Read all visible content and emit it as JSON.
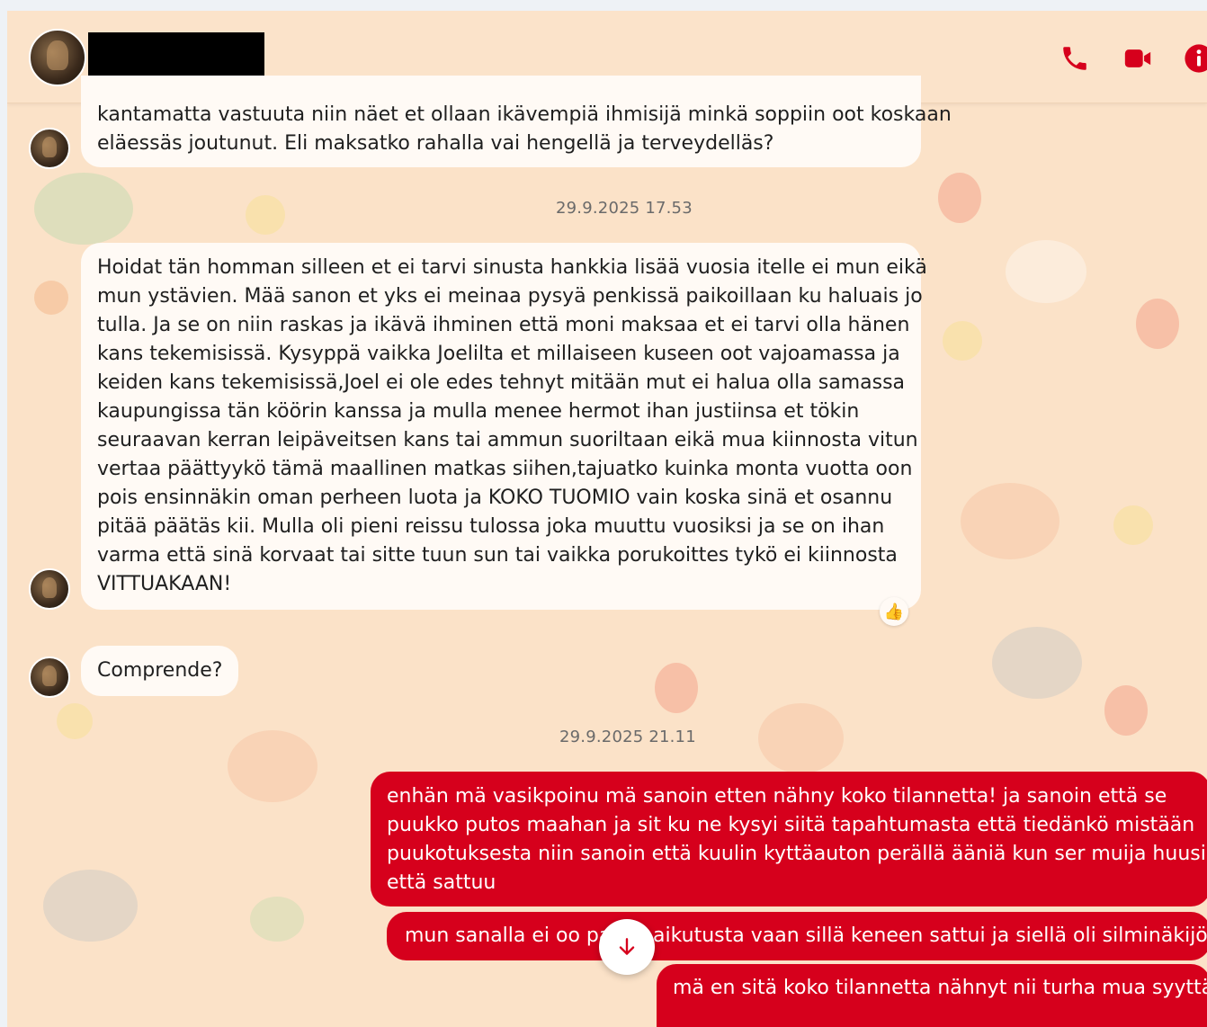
{
  "header": {
    "contact_name_redacted": "",
    "call_icon": "phone-icon",
    "video_icon": "video-camera-icon",
    "info_icon": "info-icon"
  },
  "colors": {
    "accent": "#d6001c",
    "background": "#fbe2c8",
    "incoming_bubble": "#fffaf5"
  },
  "messages": {
    "m1": {
      "lines": [
        "kantamatta vastuuta niin näet et ollaan ikävempiä ihmisijä minkä soppiin oot koskaan",
        "eläessäs joutunut. Eli maksatko rahalla vai hengellä ja terveydelläs?"
      ]
    },
    "stamp1": "29.9.2025 17.53",
    "m2": {
      "lines": [
        "Hoidat tän homman silleen et ei tarvi sinusta hankkia lisää vuosia itelle ei mun eikä",
        "mun ystävien. Mää sanon et yks ei meinaa pysyä penkissä paikoillaan ku haluais jo",
        "tulla. Ja se on niin raskas ja ikävä ihminen että moni maksaa et ei tarvi olla hänen",
        "kans tekemisissä. Kysyppä vaikka Joelilta et millaiseen kuseen oot vajoamassa ja",
        "keiden kans tekemisissä,Joel ei ole edes tehnyt mitään mut ei halua olla samassa",
        "kaupungissa tän köörin kanssa ja mulla menee hermot ihan justiinsa et tökin",
        "seuraavan kerran leipäveitsen kans tai ammun suoriltaan eikä mua kiinnosta vitun",
        "vertaa päättyykö tämä maallinen matkas siihen,tajuatko kuinka monta vuotta oon",
        "pois ensinnäkin oman perheen luota ja KOKO TUOMIO vain koska sinä et osannu",
        "pitää päätäs kii. Mulla oli pieni reissu tulossa joka muuttu vuosiksi ja se on ihan",
        "varma että sinä korvaat tai sitte tuun sun tai vaikka porukoittes tykö ei kiinnosta",
        "VITTUAKAAN!"
      ],
      "reaction": "👍"
    },
    "m3": {
      "text": "Comprende?"
    },
    "stamp2": "29.9.2025 21.11",
    "m4": {
      "lines": [
        "enhän mä vasikpoinu mä sanoin etten nähny koko tilannetta! ja sanoin että se",
        "puukko putos maahan ja sit ku ne kysyi siitä tapahtumasta että tiedänkö mistään",
        "puukotuksesta niin sanoin että kuulin kyttäauton perällä ääniä kun ser muija huusi",
        "että sattuu"
      ]
    },
    "m5": {
      "left_text": "mun sanalla ei oo pa",
      "right_text": "aikutusta vaan sillä keneen sattui ja siellä oli silminäkijöitä"
    },
    "m6": {
      "text": "mä en sitä koko tilannetta nähnyt nii turha mua syyttää"
    }
  },
  "scroll_button": {
    "icon": "arrow-down-icon"
  }
}
